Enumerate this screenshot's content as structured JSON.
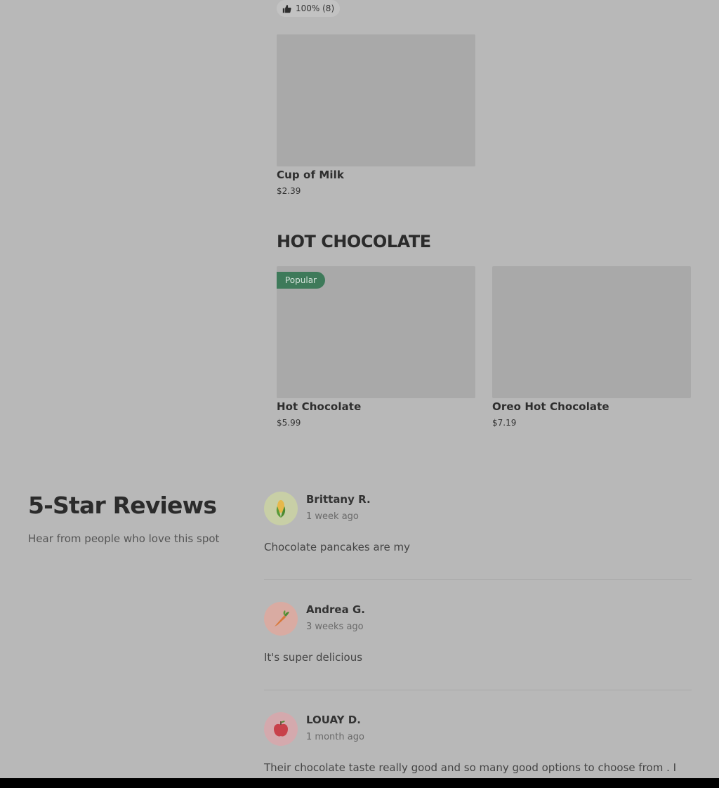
{
  "top_item": {
    "rating_text": "100% (8)"
  },
  "menu_items_top": [
    {
      "name": "Cup of Milk",
      "price": "$2.39"
    }
  ],
  "hot_chocolate_section": {
    "title": "HOT CHOCOLATE",
    "badge": "Popular",
    "items": [
      {
        "name": "Hot Chocolate",
        "price": "$5.99"
      },
      {
        "name": "Oreo Hot Chocolate",
        "price": "$7.19"
      }
    ]
  },
  "reviews": {
    "title": "5-Star Reviews",
    "subtitle": "Hear from people who love this spot",
    "items": [
      {
        "name": "Brittany R.",
        "time": "1 week ago",
        "text": "Chocolate pancakes are my",
        "avatar_icon": "corn-icon",
        "avatar_color": "#c8cfa6"
      },
      {
        "name": "Andrea G.",
        "time": "3 weeks ago",
        "text": "It's super delicious",
        "avatar_icon": "carrot-icon",
        "avatar_color": "#d9aba2"
      },
      {
        "name": "LOUAY D.",
        "time": "1 month ago",
        "text": "Their chocolate taste really good and so many good options to choose from . I",
        "avatar_icon": "apple-icon",
        "avatar_color": "#d4a9ad"
      }
    ]
  },
  "colors": {
    "background": "#b8b8b8",
    "popular_badge": "#3e7a5a",
    "image_placeholder": "#a9a9a9"
  }
}
